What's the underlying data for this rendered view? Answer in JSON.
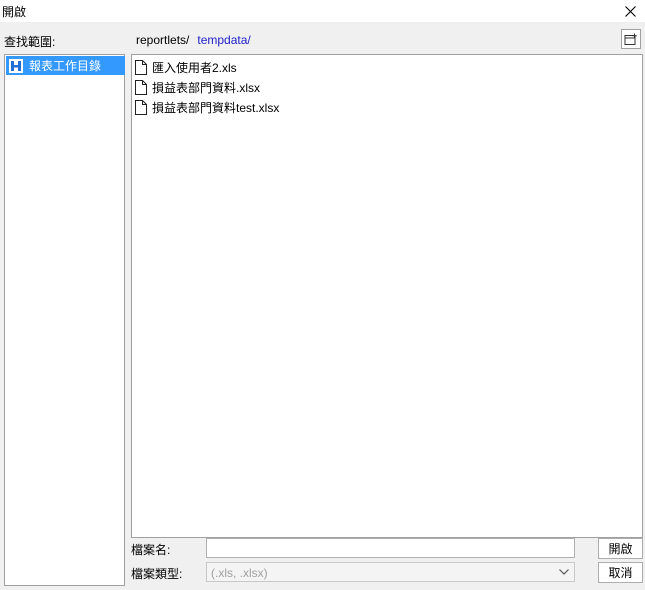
{
  "window": {
    "title": "開啟"
  },
  "toolbar": {
    "look_in_label": "查找範圍:",
    "breadcrumb": [
      "reportlets/",
      "tempdata/"
    ]
  },
  "sidebar": {
    "items": [
      {
        "label": "報表工作目錄",
        "icon": "folder-app-icon",
        "selected": true
      }
    ]
  },
  "files": [
    {
      "name": "匯入使用者2.xls",
      "icon": "document-icon"
    },
    {
      "name": "損益表部門資料.xlsx",
      "icon": "document-icon"
    },
    {
      "name": "損益表部門資料test.xlsx",
      "icon": "document-icon"
    }
  ],
  "footer": {
    "filename_label": "檔案名:",
    "filename_value": "",
    "filetype_label": "檔案類型:",
    "filetype_value": "(.xls, .xlsx)",
    "open_button": "開啟",
    "cancel_button": "取消"
  },
  "colors": {
    "selection": "#3399ff",
    "link": "#2020c8"
  }
}
